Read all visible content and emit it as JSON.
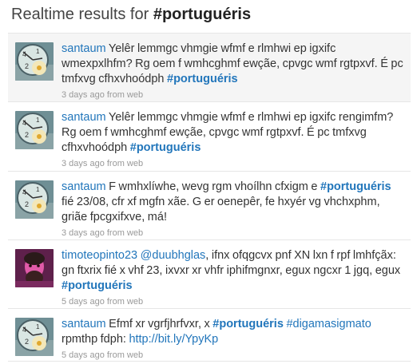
{
  "header": {
    "prefix": "Realtime results for ",
    "query": "#portuguéris"
  },
  "tweets": [
    {
      "user": "santaum",
      "avatar": "clock-flower-avatar",
      "text": " Yelêr lemmgc vhmgie wfmf e rlmhwi ep igxifc wmexpxlhfm? Rg oem f wmhcghmf ewçãe, cpvgc wmf rgtpxvf. É pc tmfxvg cfhxvhoódph ",
      "hashtag": "#portuguéris",
      "meta": "3 days ago from web"
    },
    {
      "user": "santaum",
      "avatar": "clock-flower-avatar",
      "text": " Yelêr lemmgc vhmgie wfmf e rlmhwi ep igxifc rengimfm? Rg oem f wmhcghmf ewçãe, cpvgc wmf rgtpxvf. É pc tmfxvg cfhxvhoódph ",
      "hashtag": "#portuguéris",
      "meta": "3 days ago from web"
    },
    {
      "user": "santaum",
      "avatar": "clock-flower-avatar",
      "text": " F wmhxlíwhe, wevg rgm vhoílhn cfxigm e ",
      "hashtag": "#portuguéris",
      "text_after": " fié 23/08, cfr xf mgfn xãe. G er oenepêr, fe hxyér vg vhchxphm, griãe fpcgxifxve, má!",
      "meta": "3 days ago from web"
    },
    {
      "user": "timoteopinto23",
      "avatar": "pink-portrait-avatar",
      "mention": "@duubhglas",
      "text": ", ifnx ofqgcvx pnf XN lxn f rpf lmhfçãx: gn ftxrix fié x vhf 23, ixvxr xr vhfr iphifmgnxr, egux ngcxr 1 jgq, egux ",
      "hashtag": "#portuguéris",
      "meta": "5 days ago from web"
    },
    {
      "user": "santaum",
      "avatar": "clock-flower-avatar",
      "text": " Efmf xr vgrfjhrfvxr, x ",
      "hashtag": "#portuguéris",
      "hashtag2": "#digamasigmato",
      "text_mid": " rpmthp fdph: ",
      "link": "http://bit.ly/YpyKp",
      "meta": "5 days ago from web"
    }
  ],
  "colors": {
    "link": "#2276bb",
    "meta": "#999999",
    "hover_bg": "#f5f5f5"
  }
}
